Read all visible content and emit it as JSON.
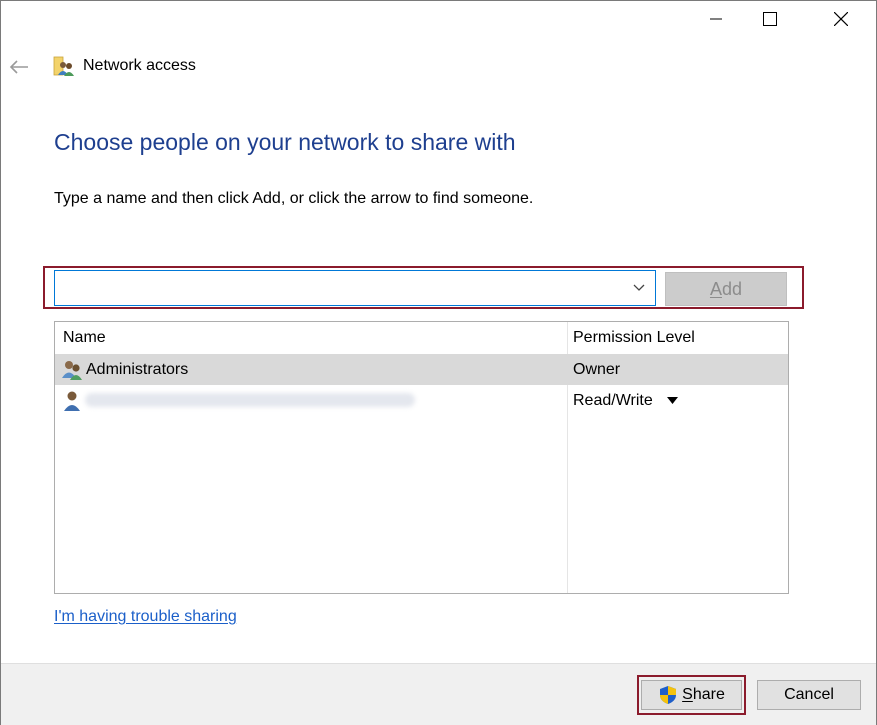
{
  "window": {
    "app_title": "Network access",
    "icons": [
      "back-arrow-icon",
      "network-users-icon",
      "minimize-icon",
      "maximize-icon",
      "close-icon"
    ]
  },
  "main": {
    "heading": "Choose people on your network to share with",
    "instruction": "Type a name and then click Add, or click the arrow to find someone.",
    "name_input": {
      "value": "",
      "placeholder": ""
    },
    "add_button": {
      "prefix": "",
      "accel": "A",
      "rest": "dd",
      "state": "disabled"
    },
    "table": {
      "columns": [
        "Name",
        "Permission Level"
      ],
      "rows": [
        {
          "name": "Administrators",
          "permission": "Owner",
          "icon": "group-users-icon",
          "selected": true
        },
        {
          "name": "",
          "permission": "Read/Write",
          "icon": "user-icon",
          "selected": false,
          "name_obscured": true
        }
      ]
    },
    "trouble_link": "I'm having trouble sharing"
  },
  "footer": {
    "share_button": {
      "accel": "S",
      "rest": "hare",
      "icon": "uac-shield-icon"
    },
    "cancel_button": "Cancel"
  },
  "colors": {
    "heading": "#1e3f8f",
    "link": "#1b5fc9",
    "highlight_box": "#8b1b2c",
    "input_focus_border": "#0078d7",
    "selected_row": "#d9d9d9",
    "footer_bg": "#f0f0f0"
  }
}
